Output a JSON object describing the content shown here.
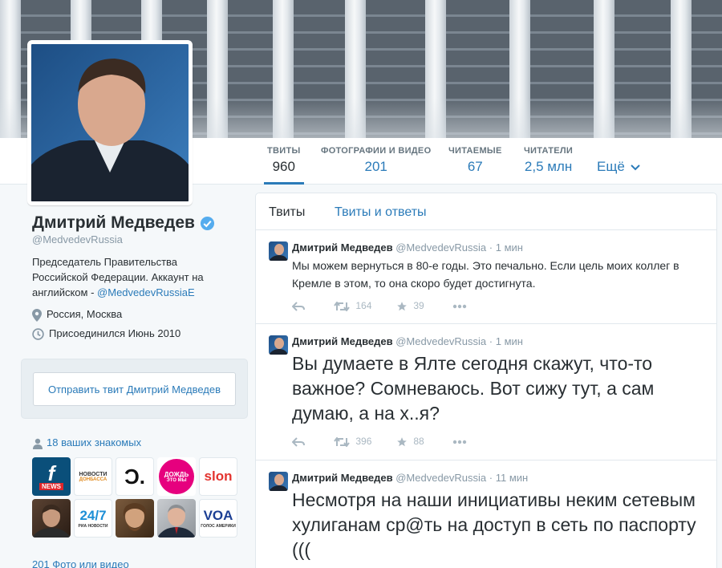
{
  "colors": {
    "accent": "#2b7bb9",
    "text": "#292f33",
    "muted": "#8899a6",
    "icon": "#aab8c2",
    "verified": "#55acee"
  },
  "nav": {
    "stats": [
      {
        "label": "ТВИТЫ",
        "value": "960"
      },
      {
        "label": "ФОТОГРАФИИ И ВИДЕО",
        "value": "201"
      },
      {
        "label": "ЧИТАЕМЫЕ",
        "value": "67"
      },
      {
        "label": "ЧИТАТЕЛИ",
        "value": "2,5 млн"
      }
    ],
    "more": "Ещё"
  },
  "profile": {
    "name": "Дмитрий Медведев",
    "handle": "@MedvedevRussia",
    "bio_text": "Председатель Правительства Российской Федерации. Аккаунт на английском -",
    "bio_link": "@MedvedevRussiaE",
    "location": "Россия, Москва",
    "joined": "Присоединился Июнь 2010",
    "tweet_to_button": "Отправить твит Дмитрий Медведев",
    "known_followers": "18 ваших знакомых",
    "photos_link": "201 Фото или видео"
  },
  "followers_tiles": [
    {
      "text": "f",
      "sub": "NEWS",
      "icon": "f-news-logo"
    },
    {
      "text": "НОВОСТИ",
      "sub": "ДОНБАССА",
      "icon": "novosti-donbassa-logo"
    },
    {
      "text": "Ͻ.",
      "icon": "echo-logo"
    },
    {
      "text": "ДОЖДЬ",
      "sub": "ЭТО МЫ",
      "icon": "dozhd-logo"
    },
    {
      "text": "slon",
      "icon": "slon-logo"
    },
    {
      "icon": "person-photo"
    },
    {
      "text": "24/7",
      "sub": "РИА НОВОСТИ",
      "icon": "ria-novosti-logo"
    },
    {
      "icon": "person-photo"
    },
    {
      "icon": "person-photo"
    },
    {
      "text": "VOA",
      "sub": "ГОЛОС АМЕРИКИ",
      "icon": "voa-logo"
    }
  ],
  "timeline": {
    "tabs": [
      "Твиты",
      "Твиты и ответы"
    ],
    "tweets": [
      {
        "name": "Дмитрий Медведев",
        "handle": "@MedvedevRussia",
        "time": "· 1 мин",
        "text": "Мы можем вернуться в 80-е годы. Это печально. Если цель моих коллег в Кремле в этом, то она скоро будет достигнута.",
        "retweets": "164",
        "favorites": "39"
      },
      {
        "name": "Дмитрий Медведев",
        "handle": "@MedvedevRussia",
        "time": "· 1 мин",
        "text": "Вы думаете в Ялте сегодня скажут, что-то важное? Сомневаюсь. Вот сижу тут, а сам думаю, а на х..я?",
        "retweets": "396",
        "favorites": "88"
      },
      {
        "name": "Дмитрий Медведев",
        "handle": "@MedvedevRussia",
        "time": "· 11 мин",
        "text": "Несмотря на наши инициативы неким сетевым хулиганам ср@ть на доступ в сеть по паспорту  (((",
        "retweets": "",
        "favorites": ""
      }
    ]
  }
}
